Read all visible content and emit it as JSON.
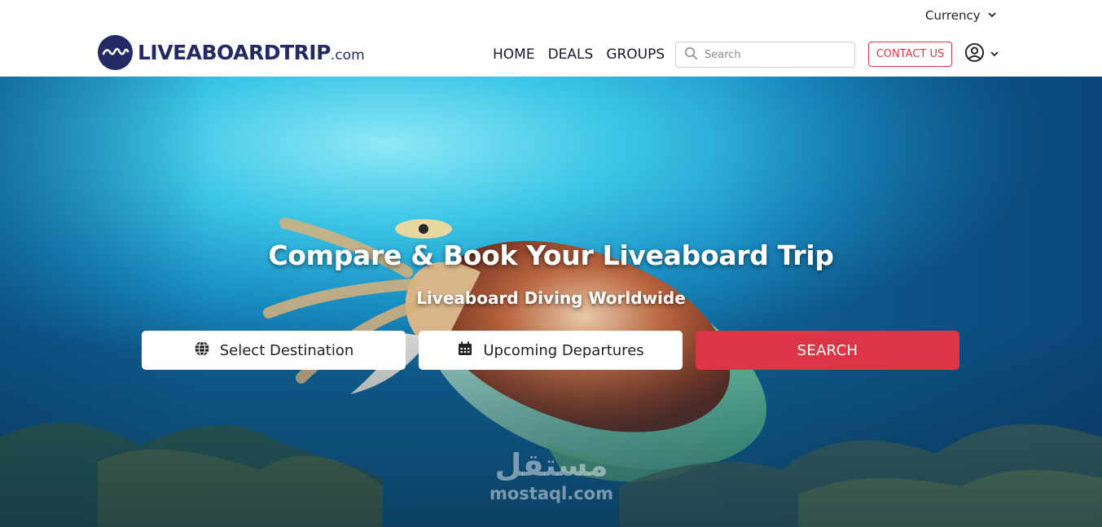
{
  "header": {
    "currency_label": "Currency",
    "logo": {
      "brand": "LIVEABOARDTRIP",
      "suffix": ".com"
    },
    "nav": [
      {
        "label": "HOME"
      },
      {
        "label": "DEALS"
      },
      {
        "label": "GROUPS"
      }
    ],
    "search": {
      "placeholder": "Search",
      "value": ""
    },
    "contact_label": "CONTACT US"
  },
  "hero": {
    "title": "Compare & Book Your Liveaboard Trip",
    "subtitle": "Liveaboard Diving Worldwide",
    "destination_label": "Select Destination",
    "departures_label": "Upcoming Departures",
    "search_label": "SEARCH"
  },
  "watermark": {
    "arabic": "مستقل",
    "latin": "mostaql.com"
  },
  "icons": {
    "currency_chevron": "chevron-down-icon",
    "search": "search-icon",
    "user": "user-circle-icon",
    "user_chevron": "chevron-down-icon",
    "destination": "globe-icon",
    "departures": "calendar-icon"
  },
  "colors": {
    "brand_navy": "#232a64",
    "accent_red": "#dc3545",
    "water_light": "#8ee8f6",
    "water_deep": "#0f5f93"
  }
}
